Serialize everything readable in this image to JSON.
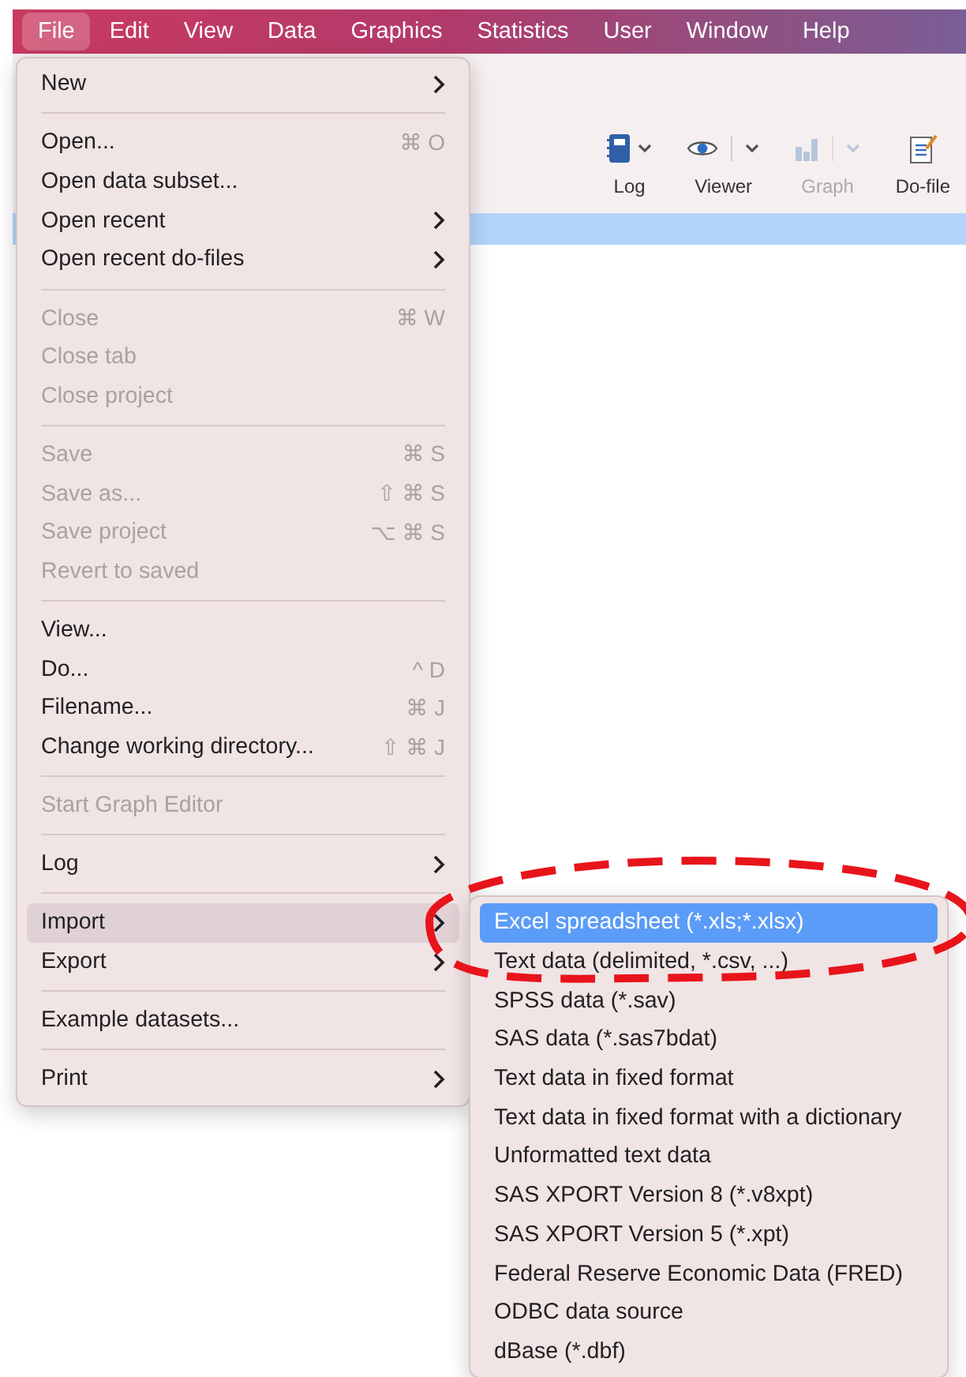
{
  "menubar": {
    "items": [
      {
        "label": "File",
        "selected": true
      },
      {
        "label": "Edit",
        "selected": false
      },
      {
        "label": "View",
        "selected": false
      },
      {
        "label": "Data",
        "selected": false
      },
      {
        "label": "Graphics",
        "selected": false
      },
      {
        "label": "Statistics",
        "selected": false
      },
      {
        "label": "User",
        "selected": false
      },
      {
        "label": "Window",
        "selected": false
      },
      {
        "label": "Help",
        "selected": false
      }
    ]
  },
  "toolbar": {
    "buttons": [
      {
        "kind": "log",
        "label": "Log",
        "disabled": false
      },
      {
        "kind": "viewer",
        "label": "Viewer",
        "disabled": false
      },
      {
        "kind": "graph",
        "label": "Graph",
        "disabled": true
      },
      {
        "kind": "dofile",
        "label": "Do-file",
        "disabled": false
      }
    ]
  },
  "file_menu": {
    "items": [
      {
        "kind": "item",
        "label": "New",
        "disabled": false,
        "has_submenu": true,
        "selected": false
      },
      {
        "kind": "separator"
      },
      {
        "kind": "item",
        "label": "Open...",
        "shortcut": "⌘ O",
        "disabled": false,
        "has_submenu": false,
        "selected": false
      },
      {
        "kind": "item",
        "label": "Open data subset...",
        "disabled": false,
        "has_submenu": false,
        "selected": false
      },
      {
        "kind": "item",
        "label": "Open recent",
        "disabled": false,
        "has_submenu": true,
        "selected": false
      },
      {
        "kind": "item",
        "label": "Open recent do-files",
        "disabled": false,
        "has_submenu": true,
        "selected": false
      },
      {
        "kind": "separator"
      },
      {
        "kind": "item",
        "label": "Close",
        "shortcut": "⌘ W",
        "disabled": true,
        "has_submenu": false,
        "selected": false
      },
      {
        "kind": "item",
        "label": "Close tab",
        "disabled": true,
        "has_submenu": false,
        "selected": false
      },
      {
        "kind": "item",
        "label": "Close project",
        "disabled": true,
        "has_submenu": false,
        "selected": false
      },
      {
        "kind": "separator"
      },
      {
        "kind": "item",
        "label": "Save",
        "shortcut": "⌘ S",
        "disabled": true,
        "has_submenu": false,
        "selected": false
      },
      {
        "kind": "item",
        "label": "Save as...",
        "shortcut": "⇧ ⌘ S",
        "disabled": true,
        "has_submenu": false,
        "selected": false
      },
      {
        "kind": "item",
        "label": "Save project",
        "shortcut": "⌥ ⌘ S",
        "disabled": true,
        "has_submenu": false,
        "selected": false
      },
      {
        "kind": "item",
        "label": "Revert to saved",
        "disabled": true,
        "has_submenu": false,
        "selected": false
      },
      {
        "kind": "separator"
      },
      {
        "kind": "item",
        "label": "View...",
        "disabled": false,
        "has_submenu": false,
        "selected": false
      },
      {
        "kind": "item",
        "label": "Do...",
        "shortcut": "^ D",
        "disabled": false,
        "has_submenu": false,
        "selected": false
      },
      {
        "kind": "item",
        "label": "Filename...",
        "shortcut": "⌘ J",
        "disabled": false,
        "has_submenu": false,
        "selected": false
      },
      {
        "kind": "item",
        "label": "Change working directory...",
        "shortcut": "⇧ ⌘ J",
        "disabled": false,
        "has_submenu": false,
        "selected": false
      },
      {
        "kind": "separator"
      },
      {
        "kind": "item",
        "label": "Start Graph Editor",
        "disabled": true,
        "has_submenu": false,
        "selected": false
      },
      {
        "kind": "separator"
      },
      {
        "kind": "item",
        "label": "Log",
        "disabled": false,
        "has_submenu": true,
        "selected": false
      },
      {
        "kind": "separator"
      },
      {
        "kind": "item",
        "label": "Import",
        "disabled": false,
        "has_submenu": true,
        "selected": true
      },
      {
        "kind": "item",
        "label": "Export",
        "disabled": false,
        "has_submenu": true,
        "selected": false
      },
      {
        "kind": "separator"
      },
      {
        "kind": "item",
        "label": "Example datasets...",
        "disabled": false,
        "has_submenu": false,
        "selected": false
      },
      {
        "kind": "separator"
      },
      {
        "kind": "item",
        "label": "Print",
        "disabled": false,
        "has_submenu": true,
        "selected": false
      }
    ]
  },
  "import_submenu": {
    "items": [
      {
        "label": "Excel spreadsheet (*.xls;*.xlsx)",
        "selected": true
      },
      {
        "label": "Text data (delimited, *.csv, ...)",
        "selected": false
      },
      {
        "label": "SPSS data (*.sav)",
        "selected": false
      },
      {
        "label": "SAS data (*.sas7bdat)",
        "selected": false
      },
      {
        "label": "Text data in fixed format",
        "selected": false
      },
      {
        "label": "Text data in fixed format with a dictionary",
        "selected": false
      },
      {
        "label": "Unformatted text data",
        "selected": false
      },
      {
        "label": "SAS XPORT Version 8 (*.v8xpt)",
        "selected": false
      },
      {
        "label": "SAS XPORT Version 5 (*.xpt)",
        "selected": false
      },
      {
        "label": "Federal Reserve Economic Data (FRED)",
        "selected": false
      },
      {
        "label": "ODBC data source",
        "selected": false
      },
      {
        "label": "dBase (*.dbf)",
        "selected": false
      }
    ]
  },
  "annotation": {
    "kind": "dashed-ellipse",
    "color": "#e8141b"
  }
}
